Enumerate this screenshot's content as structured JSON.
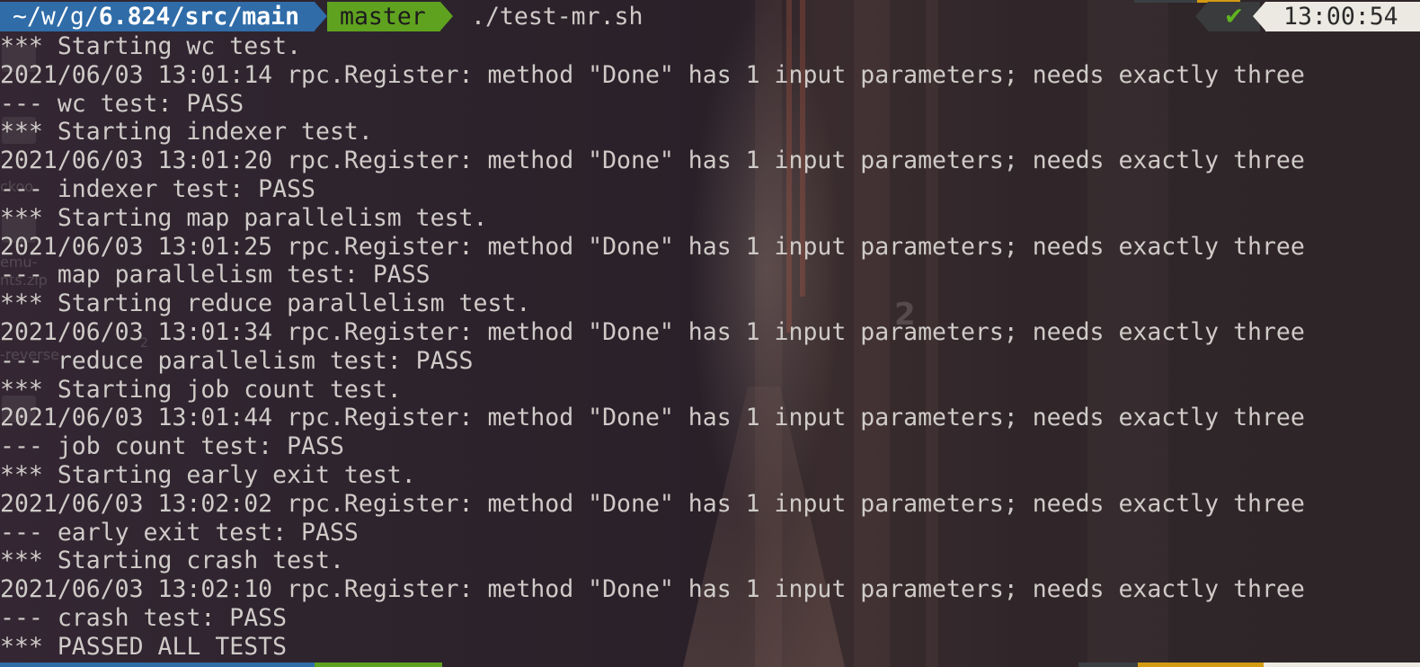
{
  "prompt": {
    "path_prefix": "~/w/g/",
    "path_bold": "6.824/src/main",
    "branch": "master",
    "command": "./test-mr.sh",
    "status_icon": "✔",
    "time": "13:00:54"
  },
  "colors": {
    "path_segment": "#2f6ca8",
    "branch_segment": "#5fa21f",
    "status_segment": "#393b3c",
    "status_ok": "#5fb41f",
    "time_segment": "#ece9e2",
    "text": "#cfcbc8"
  },
  "output": {
    "lines": [
      "*** Starting wc test.",
      "2021/06/03 13:01:14 rpc.Register: method \"Done\" has 1 input parameters; needs exactly three",
      "--- wc test: PASS",
      "*** Starting indexer test.",
      "2021/06/03 13:01:20 rpc.Register: method \"Done\" has 1 input parameters; needs exactly three",
      "--- indexer test: PASS",
      "*** Starting map parallelism test.",
      "2021/06/03 13:01:25 rpc.Register: method \"Done\" has 1 input parameters; needs exactly three",
      "--- map parallelism test: PASS",
      "*** Starting reduce parallelism test.",
      "2021/06/03 13:01:34 rpc.Register: method \"Done\" has 1 input parameters; needs exactly three",
      "--- reduce parallelism test: PASS",
      "*** Starting job count test.",
      "2021/06/03 13:01:44 rpc.Register: method \"Done\" has 1 input parameters; needs exactly three",
      "--- job count test: PASS",
      "*** Starting early exit test.",
      "2021/06/03 13:02:02 rpc.Register: method \"Done\" has 1 input parameters; needs exactly three",
      "--- early exit test: PASS",
      "*** Starting crash test.",
      "2021/06/03 13:02:10 rpc.Register: method \"Done\" has 1 input parameters; needs exactly three",
      "--- crash test: PASS",
      "*** PASSED ALL TESTS"
    ]
  },
  "background": {
    "desktop_labels": [
      "ckoo",
      "emu-",
      "nts.zip",
      "-reverse",
      "2",
      "2"
    ]
  }
}
